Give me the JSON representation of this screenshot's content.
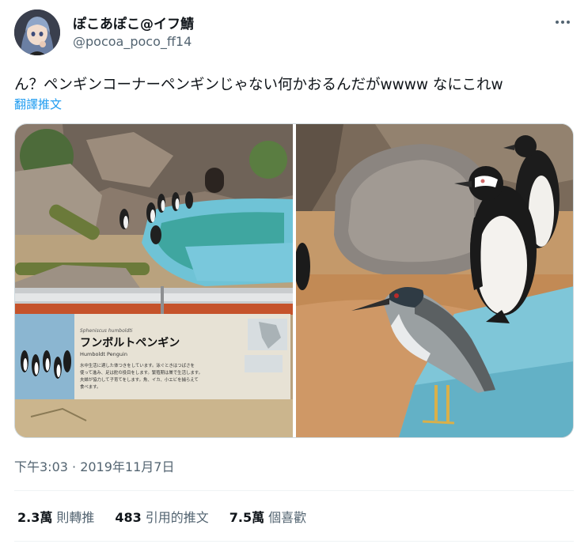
{
  "author": {
    "display_name": "ぽこあぽこ@イフ鯖",
    "handle": "@pocoa_poco_ff14",
    "avatar_icon": "anime-character-avatar"
  },
  "more_icon": "more-options-icon",
  "tweet": {
    "text": "ん？ペンギンコーナーペンギンじゃない何かおるんだがwwww なにこれw",
    "translate_label": "翻譯推文"
  },
  "media": {
    "left_photo": {
      "sign_latin": "Spheniscus humboldti",
      "sign_title": "フンボルトペンギン",
      "sign_english": "Humboldt Penguin",
      "sign_body_1": "水中生活に適した体つきをしています。泳ぐときはつばさを",
      "sign_body_2": "使って進み、足は舵の役目をします。繁殖期は巣で生活します。",
      "sign_body_3": "夫婦が協力して子育てをします。魚、イカ、小エビを捕らえて",
      "sign_body_4": "食べます。"
    }
  },
  "timestamp": "下午3:03 · 2019年11月7日",
  "stats": {
    "retweets_count": "2.3萬",
    "retweets_label": "則轉推",
    "quotes_count": "483",
    "quotes_label": "引用的推文",
    "likes_count": "7.5萬",
    "likes_label": "個喜歡"
  },
  "colors": {
    "text": "#0f1419",
    "secondary": "#536471",
    "link": "#1d9bf0",
    "border": "#cfd9de"
  }
}
